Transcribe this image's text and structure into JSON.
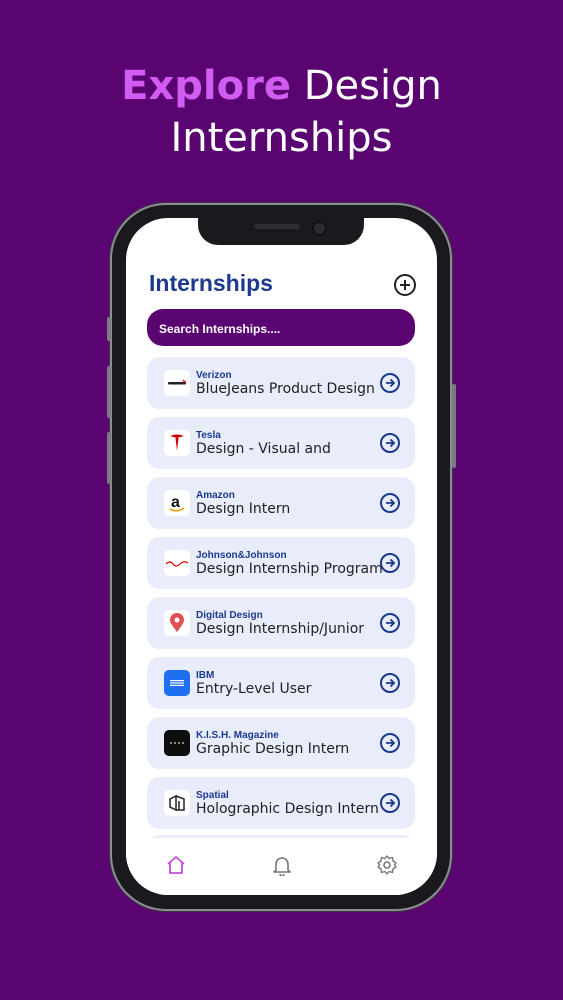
{
  "promo": {
    "accent": "Explore",
    "line1_rest": " Design",
    "line2": "Internships"
  },
  "header": {
    "title": "Internships"
  },
  "search": {
    "placeholder": "Search Internships...."
  },
  "internships": [
    {
      "company": "Verizon",
      "role": "BlueJeans Product Design",
      "logo_icon": "verizon-logo-icon"
    },
    {
      "company": "Tesla",
      "role": "Design - Visual and",
      "logo_icon": "tesla-logo-icon"
    },
    {
      "company": "Amazon",
      "role": "Design Intern",
      "logo_icon": "amazon-logo-icon"
    },
    {
      "company": "Johnson&Johnson",
      "role": "Design Internship Program",
      "logo_icon": "jnj-logo-icon"
    },
    {
      "company": "Digital Design",
      "role": "Design Internship/Junior",
      "logo_icon": "map-pin-logo-icon"
    },
    {
      "company": "IBM",
      "role": "Entry-Level User",
      "logo_icon": "ibm-logo-icon"
    },
    {
      "company": "K.I.S.H. Magazine",
      "role": "Graphic Design Intern",
      "logo_icon": "kish-logo-icon"
    },
    {
      "company": "Spatial",
      "role": "Holographic Design Intern",
      "logo_icon": "spatial-logo-icon"
    }
  ],
  "tabbar": {
    "items": [
      "home-icon",
      "bell-icon",
      "gear-icon"
    ],
    "active": "home-icon"
  },
  "colors": {
    "background": "#5a0472",
    "accent": "#d15cf2",
    "primary_text": "#1b3a8f",
    "card": "#e9ecfb",
    "tab_active": "#c04fd8"
  }
}
